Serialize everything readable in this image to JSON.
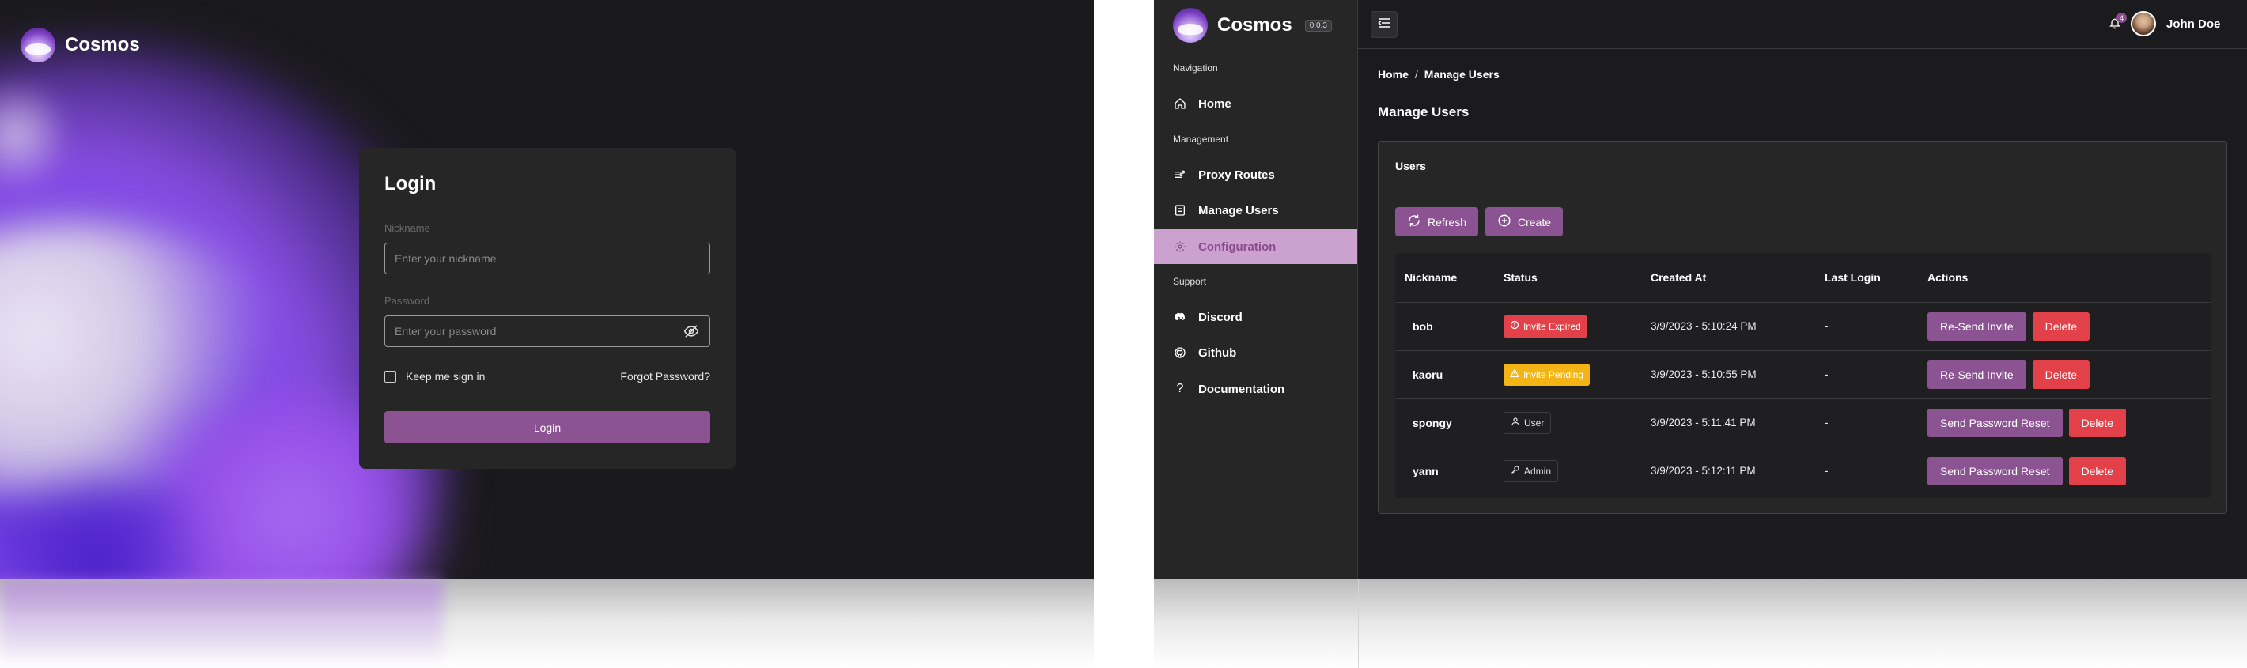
{
  "login": {
    "brand": "Cosmos",
    "title": "Login",
    "nickname_label": "Nickname",
    "nickname_placeholder": "Enter your nickname",
    "password_label": "Password",
    "password_placeholder": "Enter your password",
    "keep_signed_in": "Keep me sign in",
    "forgot_password": "Forgot Password?",
    "login_button": "Login"
  },
  "admin": {
    "brand": "Cosmos",
    "version": "0.0.3",
    "user_name": "John Doe",
    "notification_count": "4",
    "nav": {
      "navigation_heading": "Navigation",
      "home": "Home",
      "management_heading": "Management",
      "proxy_routes": "Proxy Routes",
      "manage_users": "Manage Users",
      "configuration": "Configuration",
      "support_heading": "Support",
      "discord": "Discord",
      "github": "Github",
      "documentation": "Documentation"
    },
    "breadcrumb": {
      "home": "Home",
      "separator": "/",
      "current": "Manage Users"
    },
    "page_title": "Manage Users",
    "card_title": "Users",
    "refresh_button": "Refresh",
    "create_button": "Create",
    "table": {
      "headers": [
        "Nickname",
        "Status",
        "Created At",
        "Last Login",
        "Actions"
      ],
      "rows": [
        {
          "nickname": "bob",
          "status": "Invite Expired",
          "created": "3/9/2023 - 5:10:24 PM",
          "last_login": "-",
          "primary_action": "Re-Send Invite",
          "delete": "Delete"
        },
        {
          "nickname": "kaoru",
          "status": "Invite Pending",
          "created": "3/9/2023 - 5:10:55 PM",
          "last_login": "-",
          "primary_action": "Re-Send Invite",
          "delete": "Delete"
        },
        {
          "nickname": "spongy",
          "status": "User",
          "created": "3/9/2023 - 5:11:41 PM",
          "last_login": "-",
          "primary_action": "Send Password Reset",
          "delete": "Delete"
        },
        {
          "nickname": "yann",
          "status": "Admin",
          "created": "3/9/2023 - 5:12:11 PM",
          "last_login": "-",
          "primary_action": "Send Password Reset",
          "delete": "Delete"
        }
      ]
    }
  },
  "colors": {
    "accent_purple": "#8c5393",
    "active_nav_bg": "#cba2cf",
    "danger_red": "#e2414a",
    "warning_yellow": "#f3b515",
    "background": "#1b1b1d",
    "surface": "#262627"
  },
  "icons": {
    "logo": "cosmos-logo",
    "visibility_toggle": "eye-off-icon",
    "home": "home-icon",
    "proxy_routes": "routes-icon",
    "manage_users": "users-list-icon",
    "configuration": "gear-icon",
    "discord": "discord-icon",
    "github": "github-icon",
    "documentation": "question-icon",
    "menu": "menu-icon",
    "notifications": "bell-icon",
    "refresh": "refresh-icon",
    "create": "plus-circle-icon",
    "expired": "alert-circle-icon",
    "pending": "warning-triangle-icon",
    "user_role": "user-icon",
    "admin_role": "key-icon"
  }
}
